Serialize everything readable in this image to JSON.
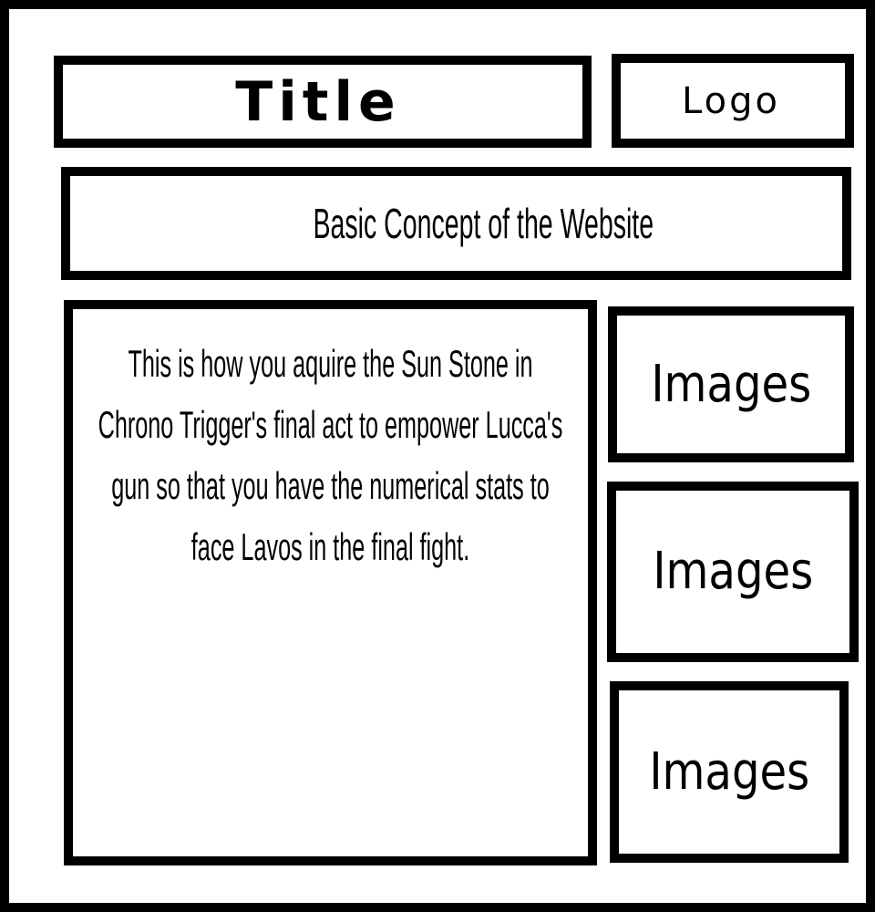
{
  "header": {
    "title": "Title",
    "logo": "Logo"
  },
  "concept": {
    "text": "Basic Concept of the Website"
  },
  "content": {
    "paragraph": "This is how you aquire the Sun Stone in Chrono Trigger's final act to empower Lucca's gun so that you have the numerical stats to face Lavos in the final fight."
  },
  "sidebar": {
    "images": [
      {
        "label": "Images"
      },
      {
        "label": "Images"
      },
      {
        "label": "Images"
      }
    ]
  },
  "colors": {
    "border": "#000000",
    "background": "#ffffff",
    "text": "#000000"
  }
}
